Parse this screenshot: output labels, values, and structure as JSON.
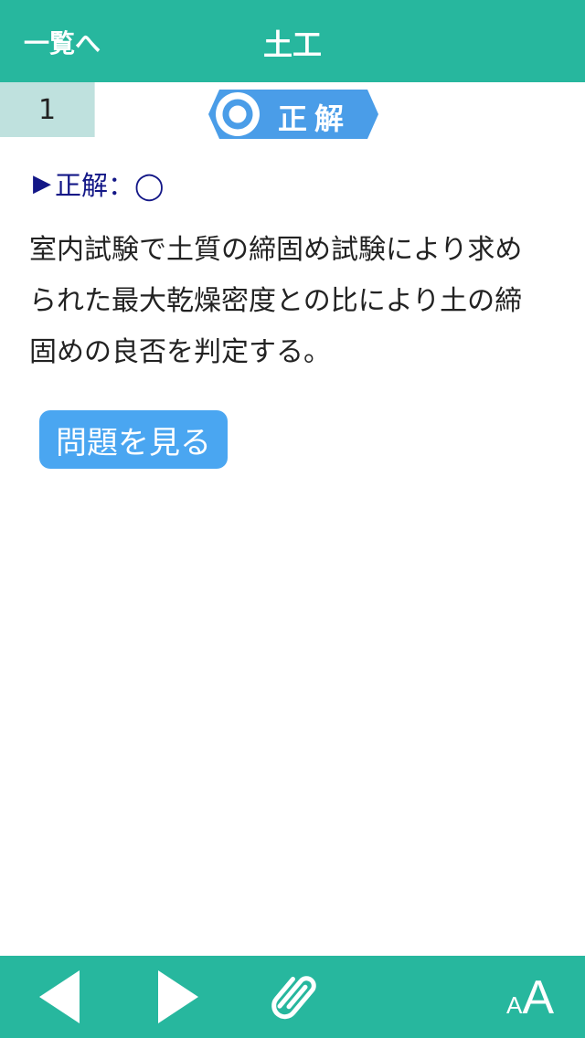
{
  "nav": {
    "back_label": "一覧へ",
    "title": "土工"
  },
  "question": {
    "number": "1"
  },
  "badge": {
    "label": "正解",
    "icon": "circle-correct-icon"
  },
  "answer": {
    "marker": "▶",
    "label": "正解：◯"
  },
  "explanation": {
    "line1": "室内試験で土質の締固め試験により求め",
    "line2": "られた最大乾燥密度との比により土の締",
    "line3": "固めの良否を判定する。"
  },
  "actions": {
    "view_question_label": "問題を見る"
  },
  "toolbar": {
    "prev_icon": "triangle-left-icon",
    "next_icon": "triangle-right-icon",
    "clip_icon": "paperclip-icon",
    "font_small": "A",
    "font_large": "A"
  },
  "colors": {
    "primary": "#27b79e",
    "number_bg": "#bfe1de",
    "badge": "#4a9de8",
    "answer_text": "#131787",
    "button": "#4aa6f1"
  }
}
